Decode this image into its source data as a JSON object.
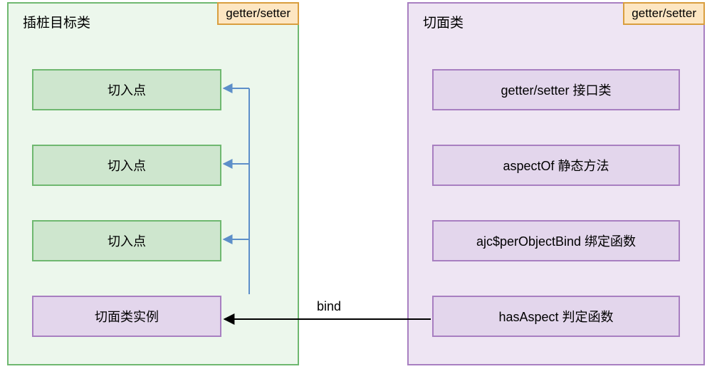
{
  "left": {
    "title": "插桩目标类",
    "badge": "getter/setter",
    "items": [
      {
        "label": "切入点"
      },
      {
        "label": "切入点"
      },
      {
        "label": "切入点"
      },
      {
        "label": "切面类实例"
      }
    ]
  },
  "right": {
    "title": "切面类",
    "badge": "getter/setter",
    "items": [
      {
        "label": "getter/setter 接口类"
      },
      {
        "label": "aspectOf 静态方法"
      },
      {
        "label": "ajc$perObjectBind 绑定函数"
      },
      {
        "label": "hasAspect 判定函数"
      }
    ]
  },
  "arrows": {
    "bind_label": "bind"
  },
  "colors": {
    "green_fill": "#ecf7ec",
    "green_border": "#6fb870",
    "green_item_fill": "#cee6ce",
    "purple_fill": "#eee5f3",
    "purple_border": "#a87fc1",
    "purple_item_fill": "#e3d6ec",
    "badge_fill": "#fde6c2",
    "badge_border": "#d99e3e",
    "blue_arrow": "#5d8fc9",
    "black_arrow": "#000000"
  }
}
